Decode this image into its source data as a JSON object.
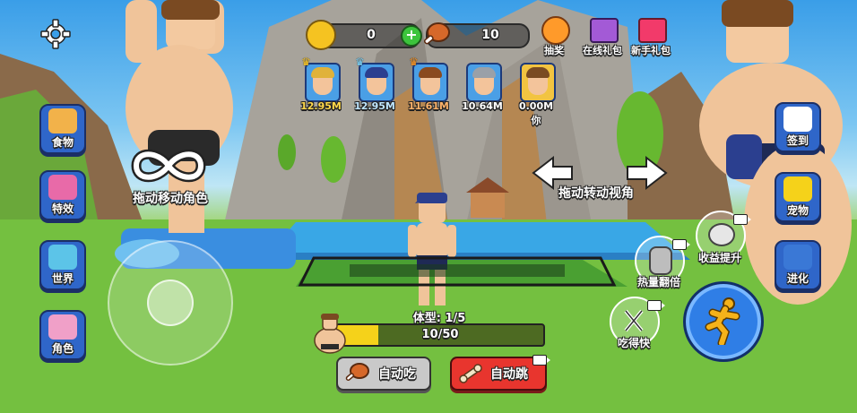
{
  "top_bar": {
    "coins": "0",
    "food": "10",
    "lottery_label": "抽奖",
    "online_gift_label": "在线礼包",
    "newbie_gift_label": "新手礼包"
  },
  "leaderboard": [
    {
      "value": "12.95M",
      "crown": "gold",
      "hair": "#e0b23a"
    },
    {
      "value": "12.95M",
      "crown": "blue",
      "hair": "#2b3f8f"
    },
    {
      "value": "11.61M",
      "crown": "gold",
      "hair": "#8a4a1f"
    },
    {
      "value": "10.64M",
      "crown": "",
      "hair": "#9aa0a8"
    },
    {
      "value": "0.00M",
      "crown": "",
      "hair": "#7a4b22",
      "me_label": "你"
    }
  ],
  "left_menu": [
    {
      "label": "食物",
      "icon": "sandwich-icon"
    },
    {
      "label": "特效",
      "icon": "effects-icon"
    },
    {
      "label": "世界",
      "icon": "map-icon"
    },
    {
      "label": "角色",
      "icon": "character-icon"
    }
  ],
  "right_menu": [
    {
      "label": "签到",
      "icon": "checkin-calendar-icon"
    },
    {
      "label": "宠物",
      "icon": "pet-icon"
    },
    {
      "label": "进化",
      "icon": "dna-icon"
    }
  ],
  "hints": {
    "move_hint": "拖动移动角色",
    "camera_hint": "拖动转动视角"
  },
  "boosts": {
    "income_label": "收益提升",
    "calorie_label": "热量翻倍",
    "eat_fast_label": "吃得快"
  },
  "progress": {
    "body_label": "体型: 1/5",
    "text": "10/50",
    "fraction": 0.2
  },
  "buttons": {
    "auto_eat": "自动吃",
    "auto_jump": "自动跳"
  },
  "colors": {
    "side_button": "#2f66c9",
    "auto_jump": "#e8352e",
    "auto_eat": "#c9c9c9",
    "progress_fill": "#f5d21a",
    "progress_track": "#4d6a22",
    "jump_button": "#2f7ee6"
  }
}
